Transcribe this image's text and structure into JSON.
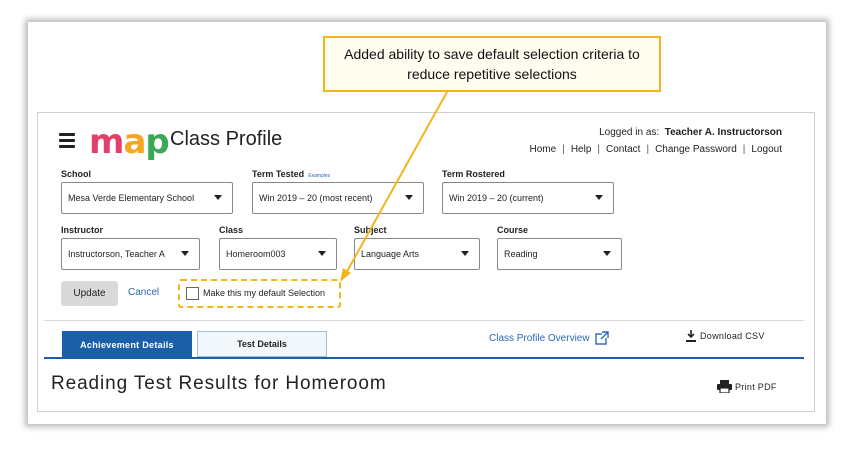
{
  "callout": {
    "text": "Added ability to save default selection criteria to\nreduce repetitive selections"
  },
  "header": {
    "logo": {
      "m": "m",
      "a": "a",
      "p": "p"
    },
    "title": "Class Profile",
    "logged_in_label": "Logged in as:",
    "user": "Teacher A. Instructorson",
    "nav": [
      "Home",
      "Help",
      "Contact",
      "Change Password",
      "Logout"
    ]
  },
  "filters": {
    "school": {
      "label": "School",
      "value": "Mesa Verde Elementary School"
    },
    "term_tested": {
      "label": "Term Tested",
      "hint": "Examples",
      "value": "Win 2019 – 20 (most recent)"
    },
    "term_rostered": {
      "label": "Term Rostered",
      "value": "Win 2019 – 20 (current)"
    },
    "instructor": {
      "label": "Instructor",
      "value": "Instructorson, Teacher A"
    },
    "class": {
      "label": "Class",
      "value": "Homeroom003"
    },
    "subject": {
      "label": "Subject",
      "value": "Language Arts"
    },
    "course": {
      "label": "Course",
      "value": "Reading"
    }
  },
  "actions": {
    "update": "Update",
    "cancel": "Cancel",
    "default_checkbox_label": "Make this my default Selection",
    "default_checked": false
  },
  "tabs": [
    {
      "label": "Achievement Details",
      "active": true
    },
    {
      "label": "Test Details",
      "active": false
    }
  ],
  "links": {
    "overview": "Class Profile Overview",
    "download": "Download CSV",
    "print": "Print PDF"
  },
  "results_title": "Reading Test Results for Homeroom",
  "colors": {
    "accent": "#1c5fa9",
    "link": "#2b66b5",
    "callout_border": "#f2b61c"
  },
  "icons": [
    "hamburger-icon",
    "external-link-icon",
    "download-icon",
    "printer-icon",
    "caret-down-icon",
    "checkbox"
  ]
}
